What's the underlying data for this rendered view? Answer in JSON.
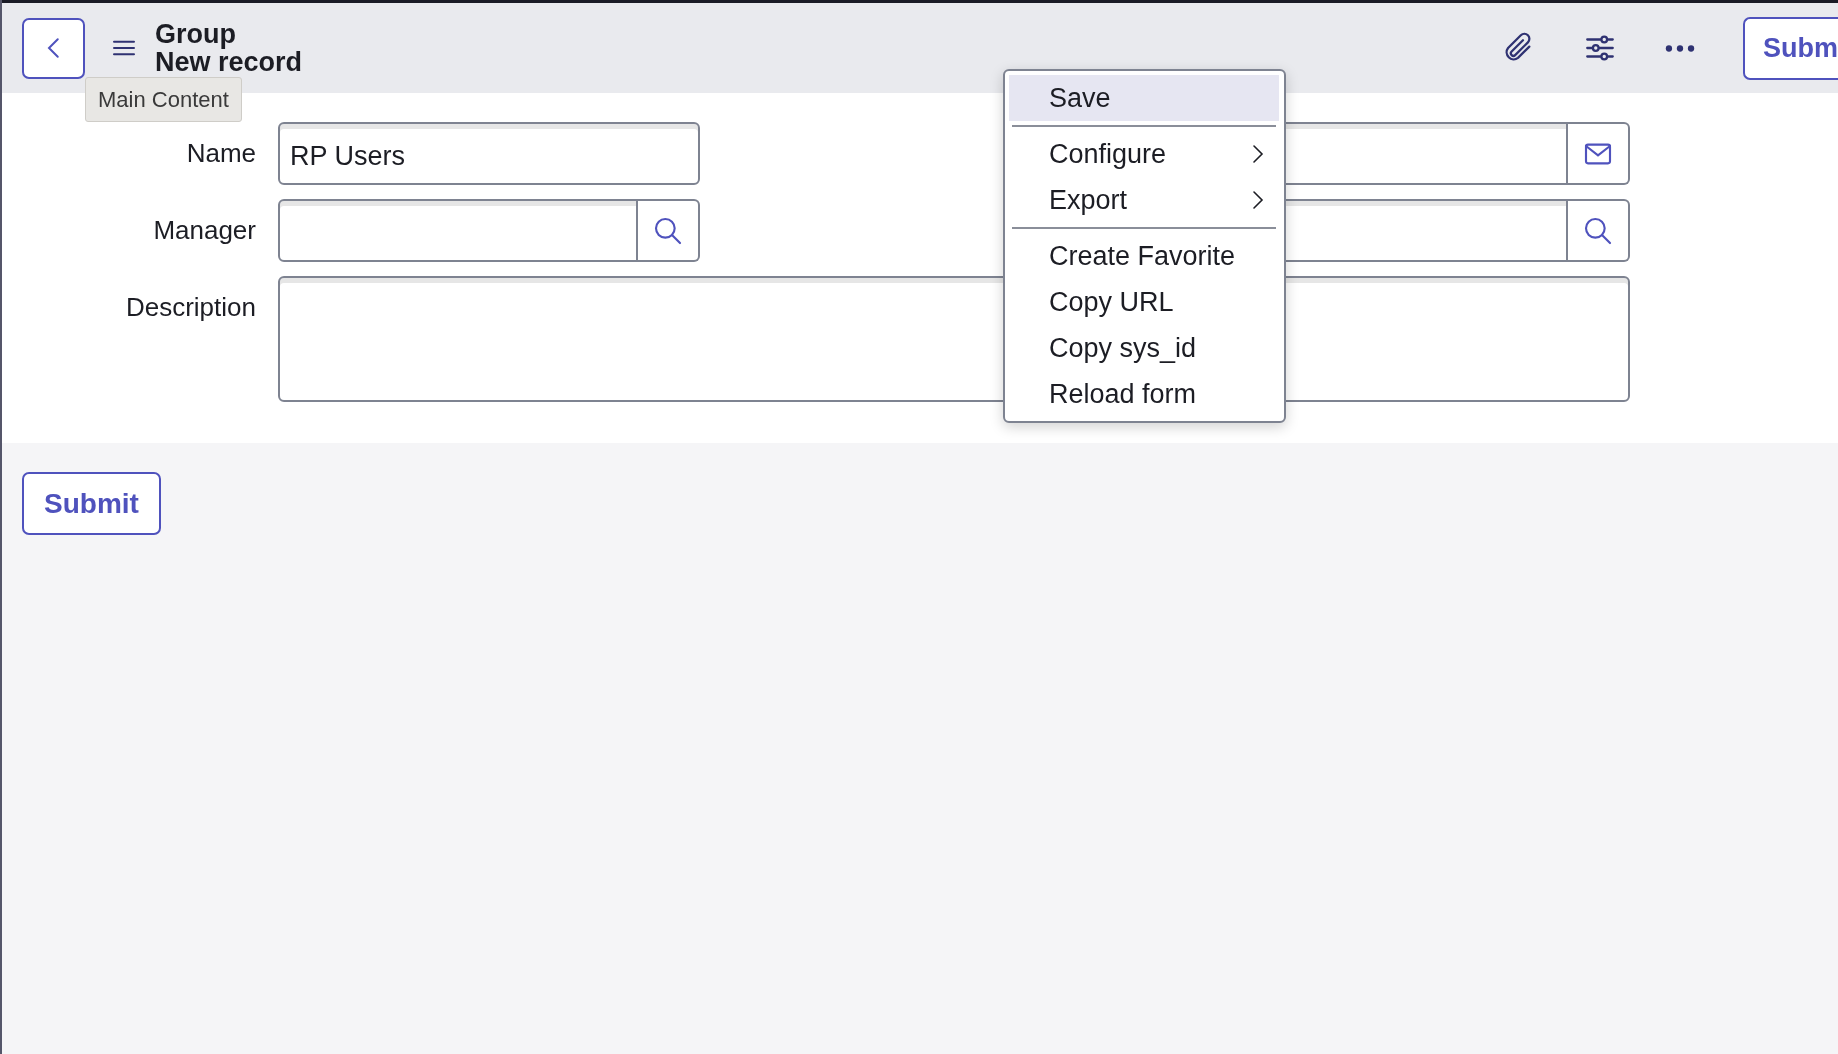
{
  "header": {
    "title": "Group",
    "subtitle": "New record",
    "tooltip": "Main Content",
    "submit_button": "Subm"
  },
  "form": {
    "fields": [
      {
        "kind": "text",
        "label": "Name",
        "value": "RP Users"
      },
      {
        "kind": "email"
      },
      {
        "kind": "lookup",
        "label": "Manager"
      },
      {
        "kind": "lookup"
      },
      {
        "kind": "textarea",
        "label": "Description"
      }
    ]
  },
  "context_menu": {
    "groups": [
      [
        {
          "label": "Save",
          "selected": true,
          "submenu": false
        }
      ],
      [
        {
          "label": "Configure",
          "selected": false,
          "submenu": true
        },
        {
          "label": "Export",
          "selected": false,
          "submenu": true
        }
      ],
      [
        {
          "label": "Create Favorite",
          "selected": false,
          "submenu": false
        },
        {
          "label": "Copy URL",
          "selected": false,
          "submenu": false
        },
        {
          "label": "Copy sys_id",
          "selected": false,
          "submenu": false
        },
        {
          "label": "Reload form",
          "selected": false,
          "submenu": false
        }
      ]
    ]
  },
  "submit_button": "Submit"
}
